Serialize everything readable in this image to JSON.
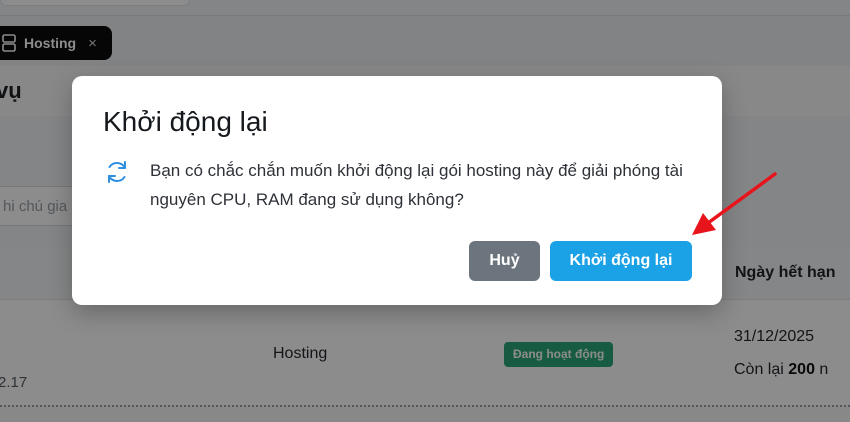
{
  "background": {
    "tab": {
      "label": "Hosting",
      "close": "×"
    },
    "section_title": "vụ",
    "note_placeholder": "hi chú gia",
    "table": {
      "header_expire": "Ngày hết hạn",
      "row": {
        "version": "2.17",
        "service": "Hosting",
        "status": "Đang hoạt động",
        "expire_date": "31/12/2025",
        "remaining_prefix": "Còn lại",
        "remaining_value": "200",
        "remaining_suffix": "n"
      }
    }
  },
  "modal": {
    "title": "Khởi động lại",
    "message": "Bạn có chắc chắn muốn khởi động lại gói hosting này để giải phóng tài nguyên CPU, RAM đang sử dụng không?",
    "cancel_label": "Huỷ",
    "confirm_label": "Khởi động lại"
  },
  "colors": {
    "confirm_button": "#1aa1e6",
    "cancel_button": "#6c757d",
    "status_badge": "#2aa878",
    "annotation_arrow": "#e8141c",
    "restart_icon": "#2f8fe0"
  },
  "icons": {
    "tab": "server-icon",
    "modal": "refresh-icon",
    "annotation": "red-arrow-icon"
  }
}
